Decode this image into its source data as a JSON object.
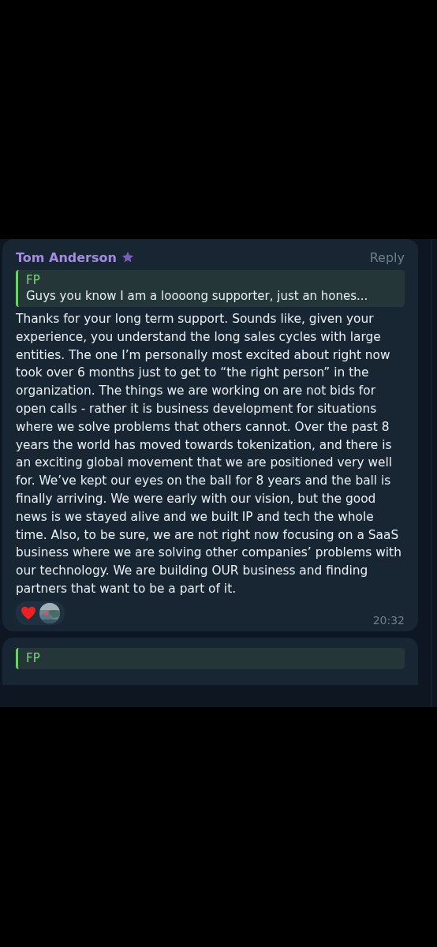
{
  "messages": [
    {
      "sender": "Tom Anderson",
      "starred": true,
      "reply_label": "Reply",
      "quote": {
        "author": "FP",
        "text": "Guys you know I am a loooong supporter, just an hones..."
      },
      "text": "Thanks for your long term support. Sounds like, given your experience, you understand the long sales cycles with large entities. The one I’m personally most excited about right now took over 6 months just to get to “the right person” in the organization. The things we are working on are not bids for open calls - rather it is business development for situations where we solve problems that others cannot. Over the past 8 years the world has moved towards tokenization, and there is an exciting global movement that we are positioned very well for. We’ve kept our eyes on the ball for 8 years and the ball is finally arriving. We were early with our vision, but the good news is we stayed alive and we built IP and tech the whole time. Also, to be sure, we are not right now focusing on a SaaS business where we are solving other companies’ problems with our technology. We are building OUR business and finding partners that want to be a part of it.",
      "reactions": [
        {
          "kind": "heart"
        },
        {
          "kind": "avatar"
        }
      ],
      "time": "20:32"
    },
    {
      "quote": {
        "author": "FP"
      }
    }
  ]
}
